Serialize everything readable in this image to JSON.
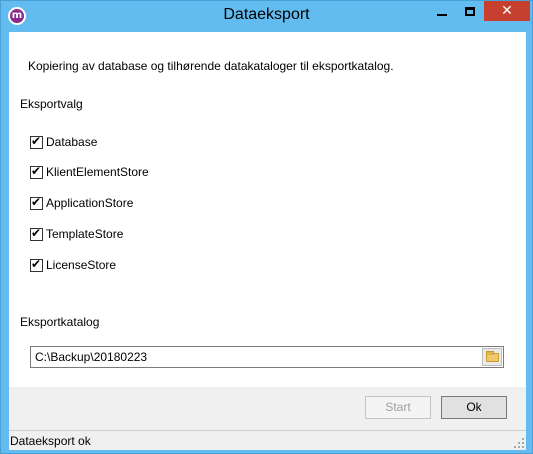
{
  "window": {
    "title": "Dataeksport",
    "icon": "m-logo-icon",
    "icon_letter": "m",
    "controls": {
      "minimize": "minimize-icon",
      "maximize": "maximize-icon",
      "close": "close-icon"
    },
    "close_glyph": "✕",
    "accent_color": "#63bcef",
    "close_color": "#c7402f"
  },
  "main": {
    "description": "Kopiering av database og tilhørende datakataloger til eksportkatalog.",
    "export_options": {
      "label": "Eksportvalg",
      "items": [
        {
          "label": "Database",
          "checked": true
        },
        {
          "label": "KlientElementStore",
          "checked": true
        },
        {
          "label": "ApplicationStore",
          "checked": true
        },
        {
          "label": "TemplateStore",
          "checked": true
        },
        {
          "label": "LicenseStore",
          "checked": true
        }
      ]
    },
    "export_directory": {
      "label": "Eksportkatalog",
      "value": "C:\\Backup\\20180223",
      "browse_icon": "folder-icon"
    }
  },
  "buttons": {
    "start_label": "Start",
    "start_enabled": false,
    "ok_label": "Ok"
  },
  "statusbar": {
    "text": "Dataeksport ok"
  }
}
